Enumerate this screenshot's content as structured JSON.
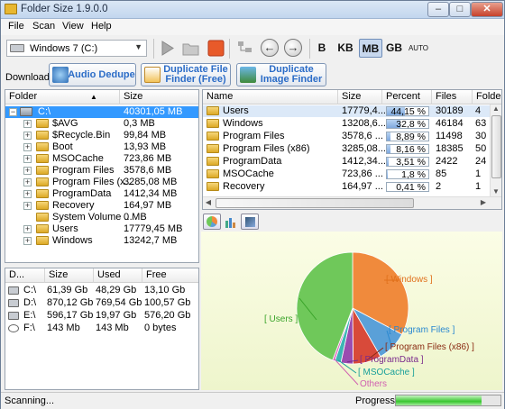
{
  "window": {
    "title": "Folder Size 1.9.0.0",
    "min": "–",
    "max": "□",
    "close": "✕"
  },
  "menu": {
    "file": "File",
    "scan": "Scan",
    "view": "View",
    "help": "Help"
  },
  "toolbar": {
    "drive": "Windows 7 (C:)",
    "units": [
      "B",
      "KB",
      "MB",
      "GB",
      "AUTO"
    ],
    "active_unit": "MB"
  },
  "download": {
    "label": "Download:",
    "audio": "Audio Dedupe",
    "dupfile_l1": "Duplicate File",
    "dupfile_l2": "Finder (Free)",
    "dupimage_l1": "Duplicate",
    "dupimage_l2": "Image Finder"
  },
  "tree": {
    "col_folder": "Folder",
    "col_size": "Size",
    "root": {
      "name": "C:\\",
      "size": "40301,05 MB"
    },
    "items": [
      {
        "name": "$AVG",
        "size": "0,3 MB"
      },
      {
        "name": "$Recycle.Bin",
        "size": "99,84 MB"
      },
      {
        "name": "Boot",
        "size": "13,93 MB"
      },
      {
        "name": "MSOCache",
        "size": "723,86 MB"
      },
      {
        "name": "Program Files",
        "size": "3578,6 MB"
      },
      {
        "name": "Program Files (x...",
        "size": "3285,08 MB"
      },
      {
        "name": "ProgramData",
        "size": "1412,34 MB"
      },
      {
        "name": "Recovery",
        "size": "164,97 MB"
      },
      {
        "name": "System Volume ...",
        "size": "0 MB"
      },
      {
        "name": "Users",
        "size": "17779,45 MB"
      },
      {
        "name": "Windows",
        "size": "13242,7 MB"
      }
    ]
  },
  "drives": {
    "cols": [
      "D...",
      "Size",
      "Used",
      "Free"
    ],
    "rows": [
      {
        "drive": "C:\\",
        "size": "61,39 Gb",
        "used": "48,29 Gb",
        "free": "13,10 Gb"
      },
      {
        "drive": "D:\\",
        "size": "870,12 Gb",
        "used": "769,54 Gb",
        "free": "100,57 Gb"
      },
      {
        "drive": "E:\\",
        "size": "596,17 Gb",
        "used": "19,97 Gb",
        "free": "576,20 Gb"
      },
      {
        "drive": "F:\\",
        "size": "143 Mb",
        "used": "143 Mb",
        "free": "0 bytes"
      }
    ]
  },
  "list": {
    "cols": [
      "Name",
      "Size",
      "Percent",
      "Files",
      "Folders"
    ],
    "rows": [
      {
        "name": "Users",
        "size": "17779,4...",
        "percent": "44,15 %",
        "pct": 44.15,
        "files": "30189",
        "folders": "4"
      },
      {
        "name": "Windows",
        "size": "13208,6...",
        "percent": "32,8 %",
        "pct": 32.8,
        "files": "46184",
        "folders": "63"
      },
      {
        "name": "Program Files",
        "size": "3578,6 ...",
        "percent": "8,89 %",
        "pct": 8.89,
        "files": "11498",
        "folders": "30"
      },
      {
        "name": "Program Files (x86)",
        "size": "3285,08...",
        "percent": "8,16 %",
        "pct": 8.16,
        "files": "18385",
        "folders": "50"
      },
      {
        "name": "ProgramData",
        "size": "1412,34...",
        "percent": "3,51 %",
        "pct": 3.51,
        "files": "2422",
        "folders": "24"
      },
      {
        "name": "MSOCache",
        "size": "723,86 ...",
        "percent": "1,8 %",
        "pct": 1.8,
        "files": "85",
        "folders": "1"
      },
      {
        "name": "Recovery",
        "size": "164,97 ...",
        "percent": "0,41 %",
        "pct": 0.41,
        "files": "2",
        "folders": "1"
      }
    ]
  },
  "chart_data": {
    "type": "pie",
    "labels": [
      "[ Users ]",
      "[ Windows ]",
      "[ Program Files ]",
      "[ Program Files (x86) ]",
      "[ ProgramData ]",
      "[ MSOCache ]",
      "Others"
    ],
    "values": [
      44.15,
      32.8,
      8.89,
      8.16,
      3.51,
      1.8,
      0.69
    ],
    "colors": [
      "#6fc85a",
      "#f08a3c",
      "#5aa0d8",
      "#d84a3a",
      "#9a4cb0",
      "#3cb6b4",
      "#e070c0"
    ],
    "label_colors": [
      "#3aa42a",
      "#e0701c",
      "#2a88d0",
      "#8a2a12",
      "#7a2a8c",
      "#1aa09a",
      "#d060b0"
    ]
  },
  "status": {
    "text": "Scanning...",
    "progress_label": "Progress:",
    "progress": 0.82
  }
}
